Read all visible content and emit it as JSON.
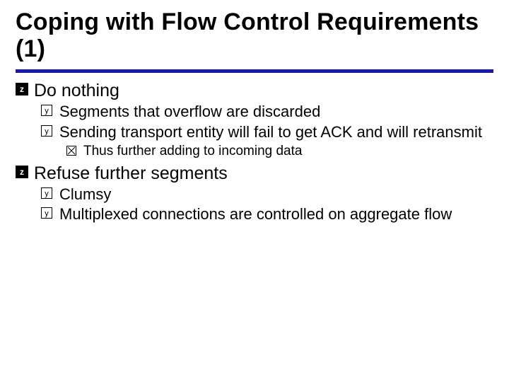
{
  "title": "Coping with Flow Control Requirements (1)",
  "items": [
    {
      "text": "Do nothing",
      "children": [
        {
          "text": "Segments that overflow are discarded"
        },
        {
          "text": "Sending transport entity will fail to get ACK and will retransmit",
          "children": [
            {
              "text": "Thus further adding to incoming data"
            }
          ]
        }
      ]
    },
    {
      "text": "Refuse further segments",
      "children": [
        {
          "text": "Clumsy"
        },
        {
          "text": "Multiplexed connections are controlled on aggregate flow"
        }
      ]
    }
  ]
}
